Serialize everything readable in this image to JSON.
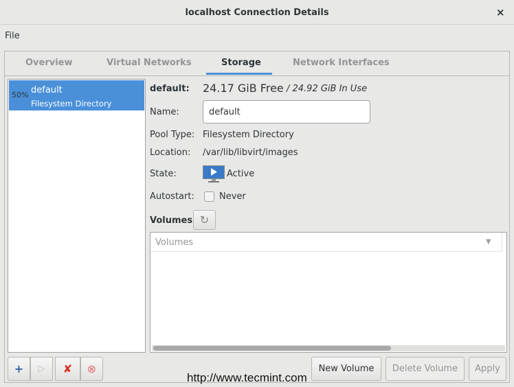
{
  "window": {
    "title": "localhost Connection Details",
    "close_icon": "×"
  },
  "menu": {
    "file": "File"
  },
  "tabs": [
    {
      "label": "Overview"
    },
    {
      "label": "Virtual Networks"
    },
    {
      "label": "Storage"
    },
    {
      "label": "Network Interfaces"
    }
  ],
  "active_tab": "Storage",
  "pools": [
    {
      "usage": "50%",
      "name": "default",
      "type": "Filesystem Directory"
    }
  ],
  "details": {
    "header_label": "default:",
    "free": "24.17 GiB Free",
    "in_use": "/ 24.92 GiB In Use",
    "name_label": "Name:",
    "name_value": "default",
    "pool_type_label": "Pool Type:",
    "pool_type_value": "Filesystem Directory",
    "location_label": "Location:",
    "location_value": "/var/lib/libvirt/images",
    "state_label": "State:",
    "state_value": "Active",
    "autostart_label": "Autostart:",
    "autostart_value": "Never",
    "volumes_label": "Volumes"
  },
  "volumes_table": {
    "columns": [
      "Volumes"
    ],
    "rows": []
  },
  "buttons": {
    "new_volume": "New Volume",
    "delete_volume": "Delete Volume",
    "apply": "Apply"
  },
  "icons": {
    "add": "+",
    "start": "▷",
    "delete": "✘",
    "stop": "⊗",
    "refresh": "↻"
  },
  "watermark": "http://www.tecmint.com",
  "colors": {
    "accent": "#4a90d9"
  }
}
